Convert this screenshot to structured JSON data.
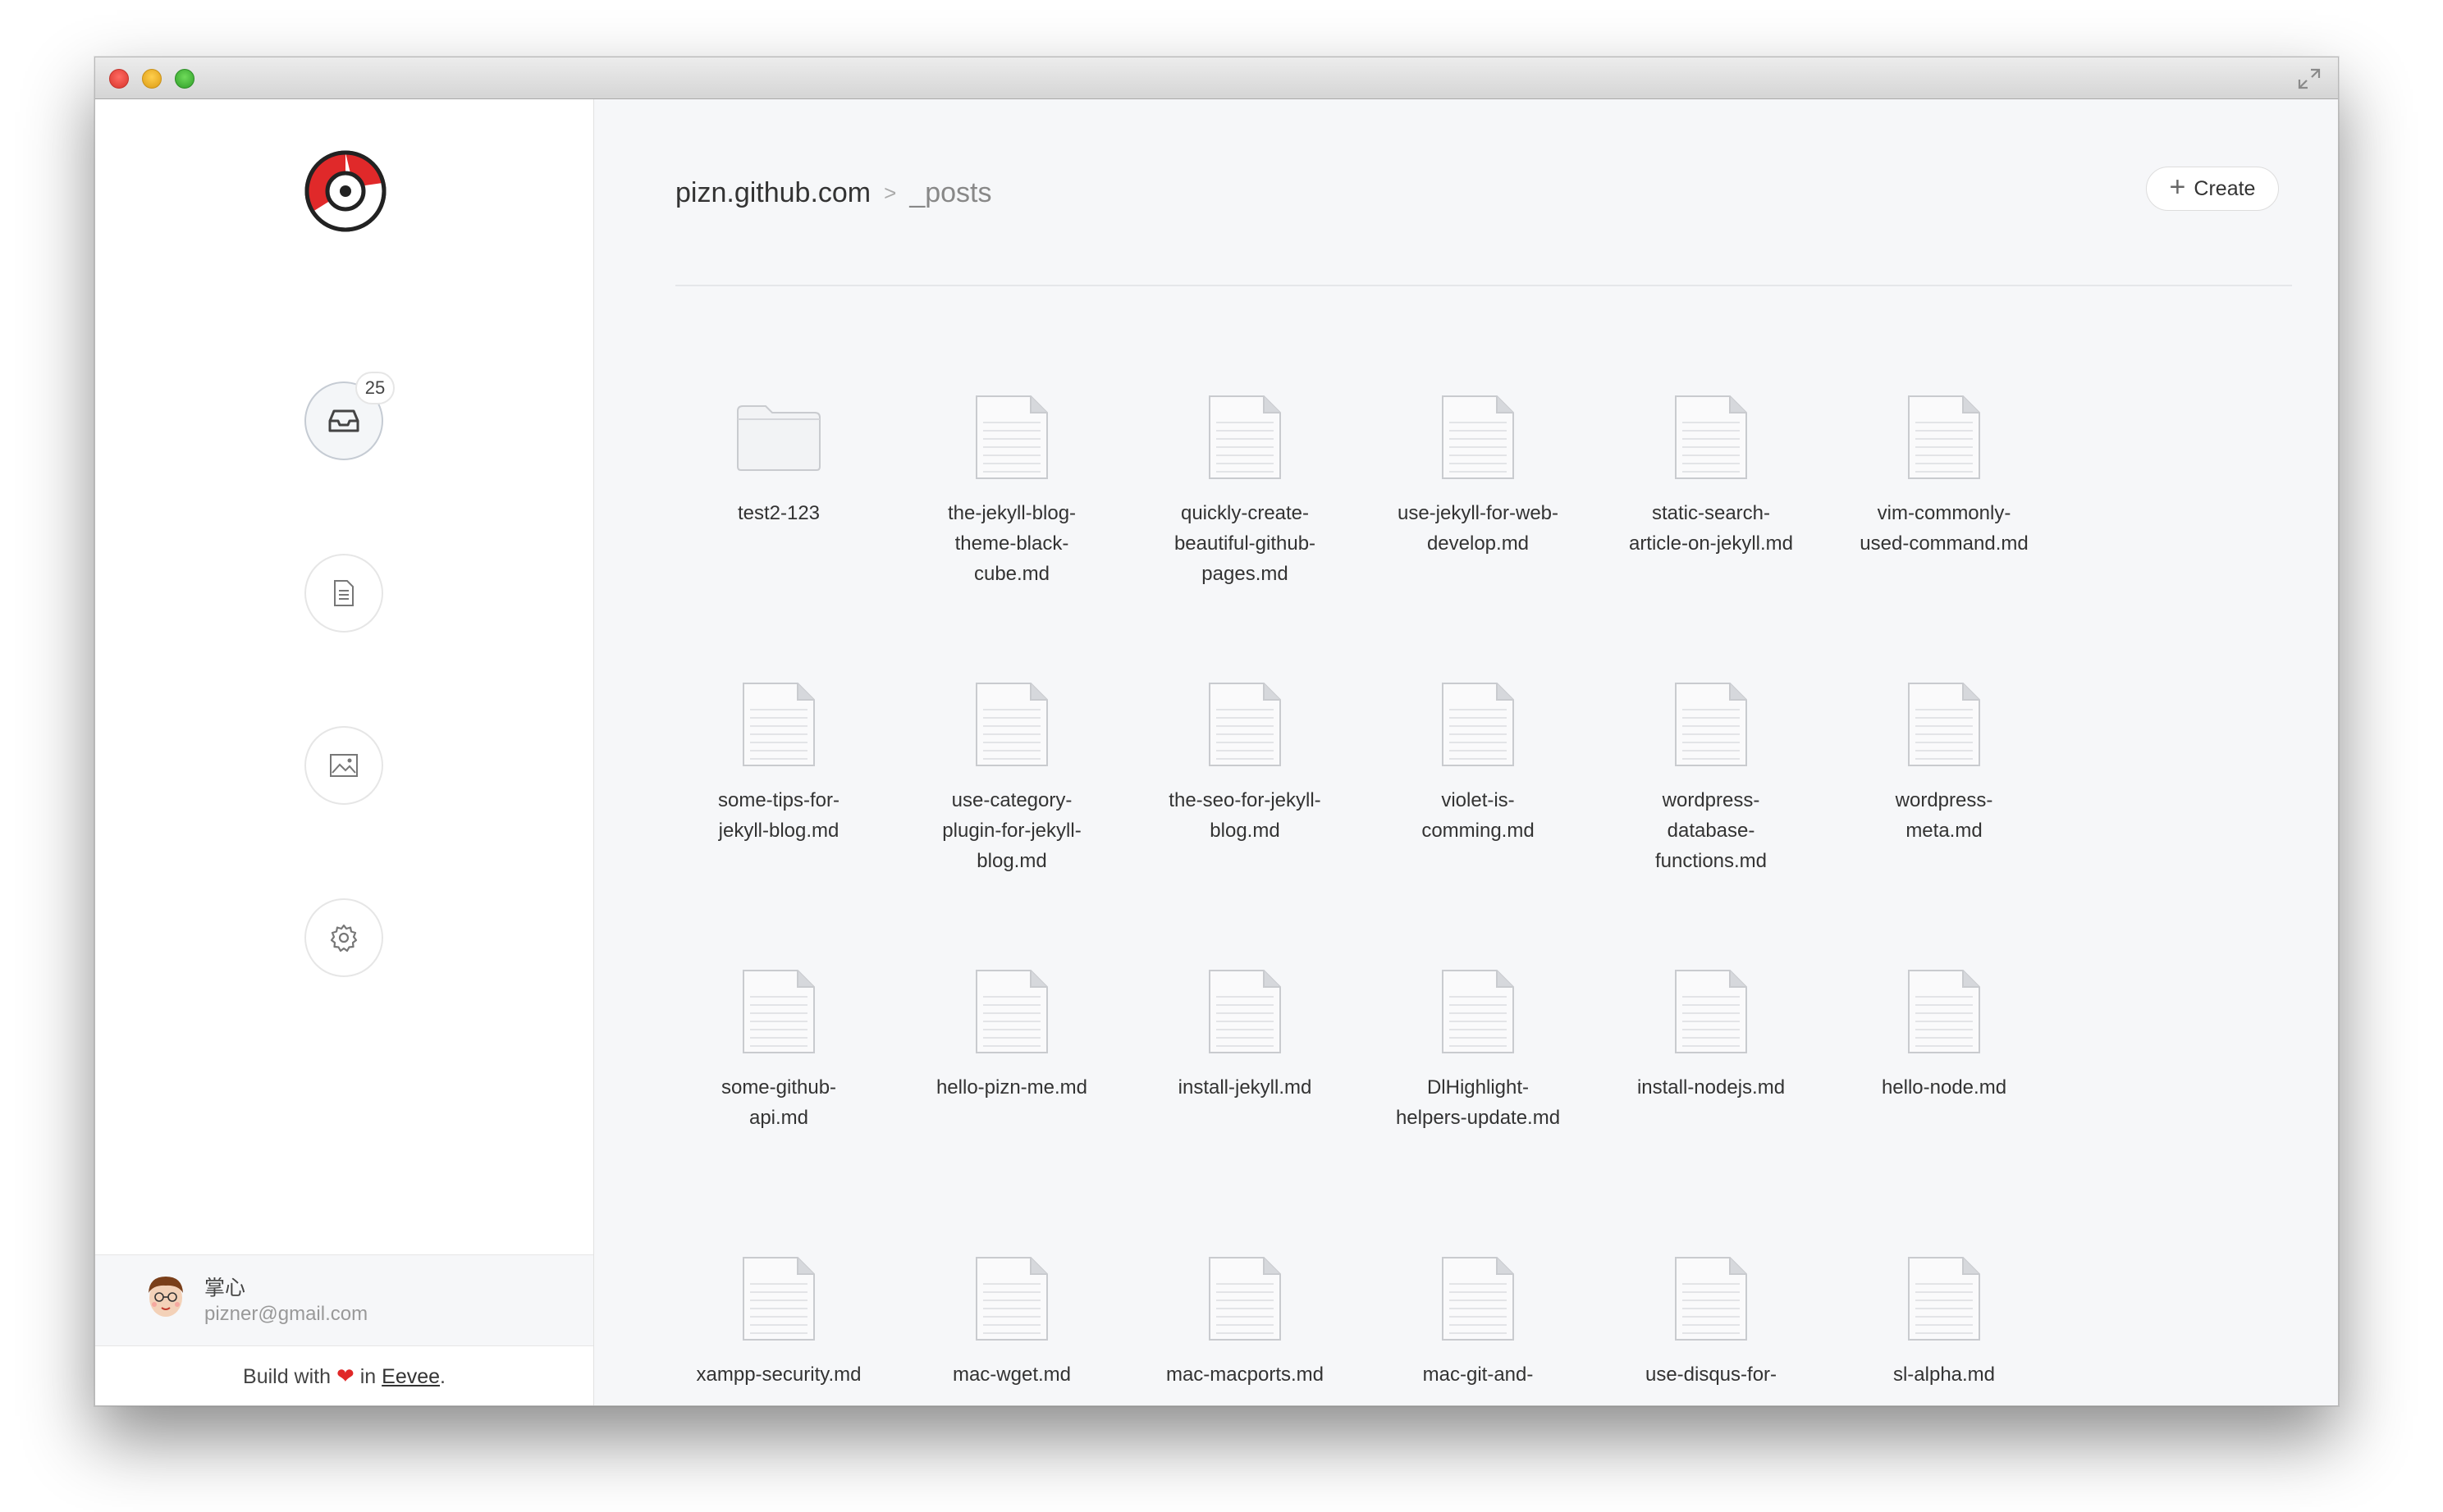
{
  "badge_count": "25",
  "user": {
    "name": "掌心",
    "email": "pizner@gmail.com"
  },
  "footer": {
    "prefix": "Build with",
    "in": "in",
    "link": "Eevee",
    "suffix": "."
  },
  "breadcrumb": {
    "root": "pizn.github.com",
    "separator": ">",
    "current": "_posts"
  },
  "create_label": "Create",
  "files": [
    {
      "name": "test2-123",
      "type": "folder"
    },
    {
      "name": "the-jekyll-blog-\ntheme-black-\ncube.md",
      "type": "file"
    },
    {
      "name": "quickly-create-\nbeautiful-github-\npages.md",
      "type": "file"
    },
    {
      "name": "use-jekyll-for-web-\ndevelop.md",
      "type": "file"
    },
    {
      "name": "static-search-\narticle-on-jekyll.md",
      "type": "file"
    },
    {
      "name": "vim-commonly-\nused-command.md",
      "type": "file"
    },
    {
      "name": "some-tips-for-\njekyll-blog.md",
      "type": "file"
    },
    {
      "name": "use-category-\nplugin-for-jekyll-\nblog.md",
      "type": "file"
    },
    {
      "name": "the-seo-for-jekyll-\nblog.md",
      "type": "file"
    },
    {
      "name": "violet-is-\ncomming.md",
      "type": "file"
    },
    {
      "name": "wordpress-\ndatabase-\nfunctions.md",
      "type": "file"
    },
    {
      "name": "wordpress-\nmeta.md",
      "type": "file"
    },
    {
      "name": "some-github-\napi.md",
      "type": "file"
    },
    {
      "name": "hello-pizn-me.md",
      "type": "file"
    },
    {
      "name": "install-jekyll.md",
      "type": "file"
    },
    {
      "name": "DlHighlight-\nhelpers-update.md",
      "type": "file"
    },
    {
      "name": "install-nodejs.md",
      "type": "file"
    },
    {
      "name": "hello-node.md",
      "type": "file"
    },
    {
      "name": "xampp-security.md",
      "type": "file"
    },
    {
      "name": "mac-wget.md",
      "type": "file"
    },
    {
      "name": "mac-macports.md",
      "type": "file"
    },
    {
      "name": "mac-git-and-",
      "type": "file"
    },
    {
      "name": "use-disqus-for-",
      "type": "file"
    },
    {
      "name": "sl-alpha.md",
      "type": "file"
    }
  ]
}
